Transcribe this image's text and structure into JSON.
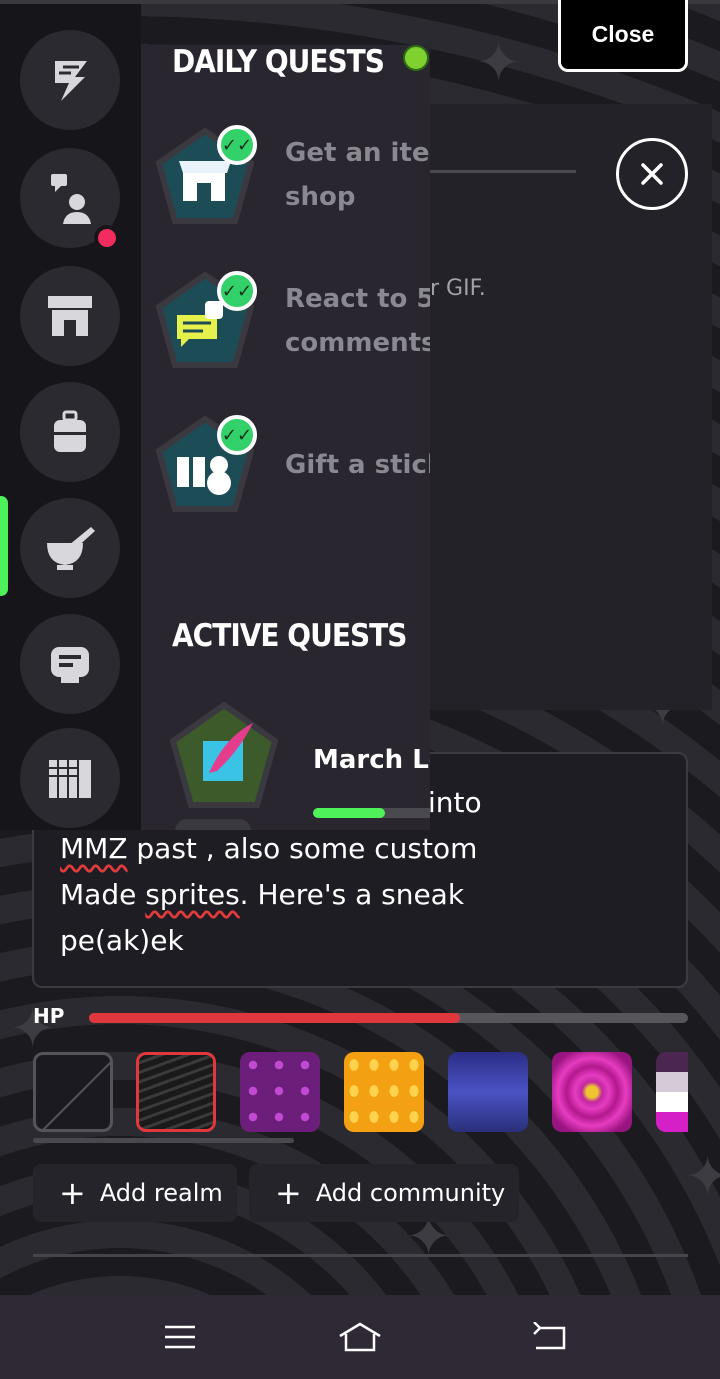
{
  "app": {
    "close_label": "Close",
    "accent_green": "#4ff15a",
    "accent_red": "#e0373c"
  },
  "quests": {
    "daily_title": "DAILY QUESTS",
    "daily": [
      {
        "icon": "shop-icon",
        "label_line1": "Get an item",
        "label_line2": "shop",
        "completed": true
      },
      {
        "icon": "chat-icon",
        "label_line1": "React to 5",
        "label_line2": "comments",
        "completed": true
      },
      {
        "icon": "gift-icon",
        "label_line1": "Gift a stick",
        "label_line2": "",
        "completed": true
      }
    ],
    "active_title": "ACTIVE QUESTS",
    "active": [
      {
        "icon": "quill-icon",
        "name": "March Lo",
        "progress": 0.6
      }
    ]
  },
  "rail": {
    "items": [
      {
        "icon": "lightning-icon"
      },
      {
        "icon": "person-chat-icon",
        "has_notification": true
      },
      {
        "icon": "store-icon"
      },
      {
        "icon": "bag-icon"
      },
      {
        "icon": "mortar-icon",
        "active": true
      },
      {
        "icon": "robot-icon"
      },
      {
        "icon": "library-icon"
      }
    ]
  },
  "behind": {
    "partial_text": "r GIF."
  },
  "editor": {
    "line0": "into",
    "line1_word": "MMZ",
    "line1_rest": " past , also some custom",
    "line2_start": "Made ",
    "line2_word": "sprites",
    "line2_rest": ". Here's a sneak",
    "line3": "pe(ak)ek"
  },
  "hp": {
    "label": "HP",
    "value": 0.62
  },
  "themes": {
    "selected_index": 1
  },
  "actions": {
    "add_realm": "Add realm",
    "add_community": "Add community",
    "plus": "+"
  },
  "sysnav": {
    "menu_icon": "menu-icon",
    "home_icon": "home-icon",
    "back_icon": "back-icon"
  }
}
